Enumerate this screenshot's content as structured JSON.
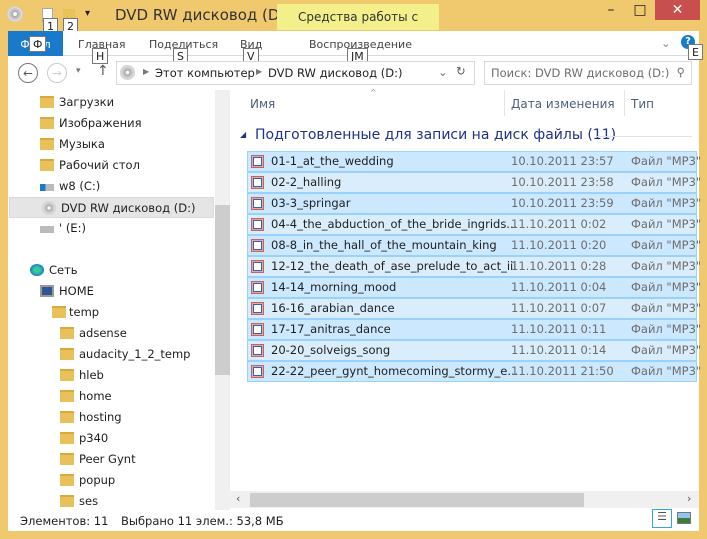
{
  "window": {
    "title": "DVD RW дисковод (D:)",
    "context_tab": "Средства работы с музыкой",
    "qat_keys": [
      "1",
      "2"
    ]
  },
  "ribbon": {
    "tabs": [
      {
        "label": "Файл",
        "key": "Ф"
      },
      {
        "label": "Главная",
        "key": "H"
      },
      {
        "label": "Поделиться",
        "key": "S"
      },
      {
        "label": "Вид",
        "key": "V"
      },
      {
        "label": "Воспроизведение",
        "key": "JM"
      }
    ],
    "help_key": "E"
  },
  "address": {
    "crumbs": [
      "Этот компьютер",
      "DVD RW дисковод (D:)"
    ],
    "search_placeholder": "Поиск: DVD RW дисковод (D:)"
  },
  "nav": {
    "items": [
      {
        "label": "Загрузки",
        "icon": "downloads-folder-icon"
      },
      {
        "label": "Изображения",
        "icon": "pictures-folder-icon"
      },
      {
        "label": "Музыка",
        "icon": "music-folder-icon"
      },
      {
        "label": "Рабочий стол",
        "icon": "desktop-folder-icon"
      },
      {
        "label": "w8 (C:)",
        "icon": "windows-drive-icon"
      },
      {
        "label": "DVD RW дисковод (D:)",
        "icon": "dvd-drive-icon",
        "selected": true
      },
      {
        "label": "' (E:)",
        "icon": "drive-icon"
      },
      {
        "label": "Сеть",
        "icon": "network-icon"
      },
      {
        "label": "HOME",
        "icon": "computer-icon"
      },
      {
        "label": "temp",
        "icon": "folder-icon"
      },
      {
        "label": "adsense",
        "icon": "folder-icon"
      },
      {
        "label": "audacity_1_2_temp",
        "icon": "folder-icon"
      },
      {
        "label": "hleb",
        "icon": "folder-icon"
      },
      {
        "label": "home",
        "icon": "folder-icon"
      },
      {
        "label": "hosting",
        "icon": "folder-icon"
      },
      {
        "label": "p340",
        "icon": "folder-icon"
      },
      {
        "label": "Peer Gynt",
        "icon": "folder-icon"
      },
      {
        "label": "popup",
        "icon": "folder-icon"
      },
      {
        "label": "ses",
        "icon": "folder-icon"
      }
    ]
  },
  "columns": {
    "name": "Имя",
    "date": "Дата изменения",
    "type": "Тип"
  },
  "group": "Подготовленные для записи на диск файлы (11)",
  "files": [
    {
      "name": "01-1_at_the_wedding",
      "date": "10.10.2011 23:57",
      "type": "Файл \"MP3\""
    },
    {
      "name": "02-2_halling",
      "date": "10.10.2011 23:58",
      "type": "Файл \"MP3\""
    },
    {
      "name": "03-3_springar",
      "date": "10.10.2011 23:59",
      "type": "Файл \"MP3\""
    },
    {
      "name": "04-4_the_abduction_of_the_bride_ingrids...",
      "date": "11.10.2011 0:02",
      "type": "Файл \"MP3\""
    },
    {
      "name": "08-8_in_the_hall_of_the_mountain_king",
      "date": "11.10.2011 0:20",
      "type": "Файл \"MP3\""
    },
    {
      "name": "12-12_the_death_of_ase_prelude_to_act_iii",
      "date": "11.10.2011 0:28",
      "type": "Файл \"MP3\""
    },
    {
      "name": "14-14_morning_mood",
      "date": "11.10.2011 0:04",
      "type": "Файл \"MP3\""
    },
    {
      "name": "16-16_arabian_dance",
      "date": "11.10.2011 0:07",
      "type": "Файл \"MP3\""
    },
    {
      "name": "17-17_anitras_dance",
      "date": "11.10.2011 0:11",
      "type": "Файл \"MP3\""
    },
    {
      "name": "20-20_solveigs_song",
      "date": "11.10.2011 0:14",
      "type": "Файл \"MP3\""
    },
    {
      "name": "22-22_peer_gynt_homecoming_stormy_e...",
      "date": "11.10.2011 21:50",
      "type": "Файл \"MP3\""
    }
  ],
  "status": {
    "count": "Элементов: 11",
    "selected": "Выбрано 11 элем.: 53,8 МБ"
  },
  "colors": {
    "frame": "#f0c86e",
    "accent": "#1979ca",
    "selection": "#cce8ff",
    "close": "#c7504f"
  }
}
